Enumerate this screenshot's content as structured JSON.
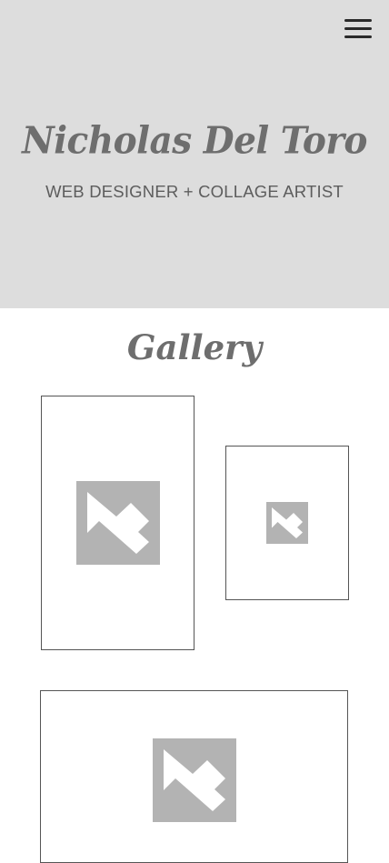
{
  "header": {
    "menu_icon": "hamburger-menu-icon",
    "title": "Nicholas Del Toro",
    "subtitle": "WEB DESIGNER + COLLAGE ARTIST"
  },
  "gallery": {
    "title": "Gallery",
    "items": [
      {
        "icon": "image-placeholder-icon"
      },
      {
        "icon": "image-placeholder-icon"
      },
      {
        "icon": "image-placeholder-icon"
      }
    ]
  },
  "colors": {
    "hero_background": "#dddddd",
    "text_gray": "#6e6e6e",
    "placeholder_gray": "#b3b3b3",
    "frame_border": "#555555"
  }
}
